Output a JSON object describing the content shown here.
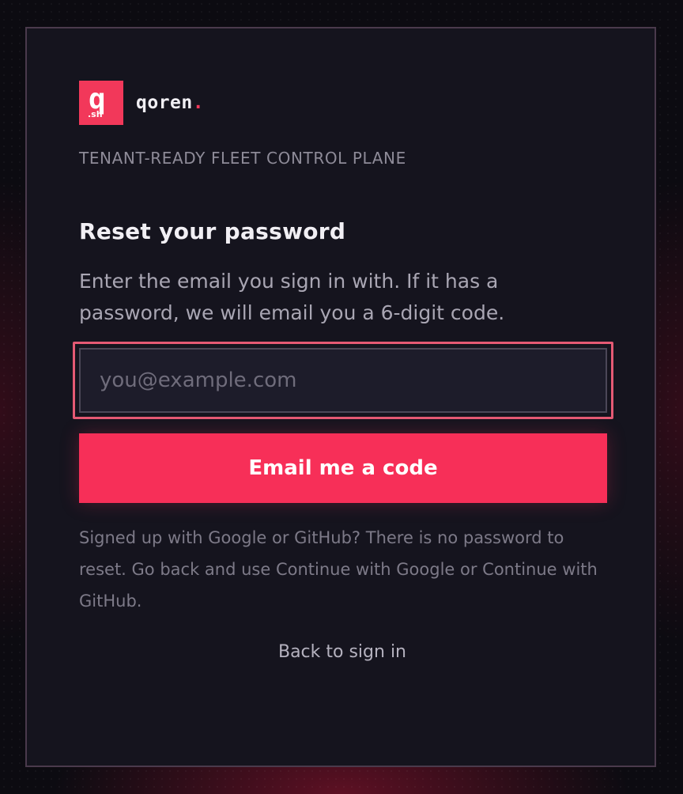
{
  "brand": {
    "mark_letter": "q",
    "mark_suffix": ".sh",
    "name": "qoren",
    "name_dot": ".",
    "accent_color": "#f2385a"
  },
  "tagline": "TENANT-READY FLEET CONTROL PLANE",
  "form": {
    "heading": "Reset your password",
    "intro": "Enter the email you sign in with. If it has a password, we will email you a 6-digit code.",
    "email_placeholder": "you@example.com",
    "email_value": "",
    "submit_label": "Email me a code"
  },
  "oauth_note": "Signed up with Google or GitHub? There is no password to reset. Go back and use Continue with Google or Continue with GitHub.",
  "back_link": "Back to sign in"
}
